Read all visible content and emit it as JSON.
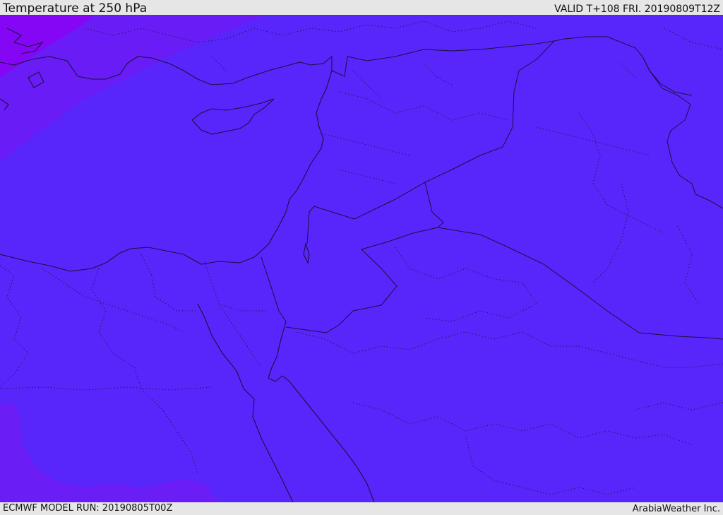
{
  "header": {
    "title": "Temperature at 250 hPa",
    "valid_time": "VALID T+108 FRI. 20190809T12Z"
  },
  "footer": {
    "model_run": "ECMWF MODEL RUN: 20190805T00Z",
    "credit": "ArabiaWeather Inc."
  },
  "colors": {
    "main_fill": "#5826fb",
    "band_violet": "#6a1cf7",
    "corner_violet": "#8406f5",
    "southwest_patch": "#6b1df6",
    "line_color": "#1a1040"
  }
}
